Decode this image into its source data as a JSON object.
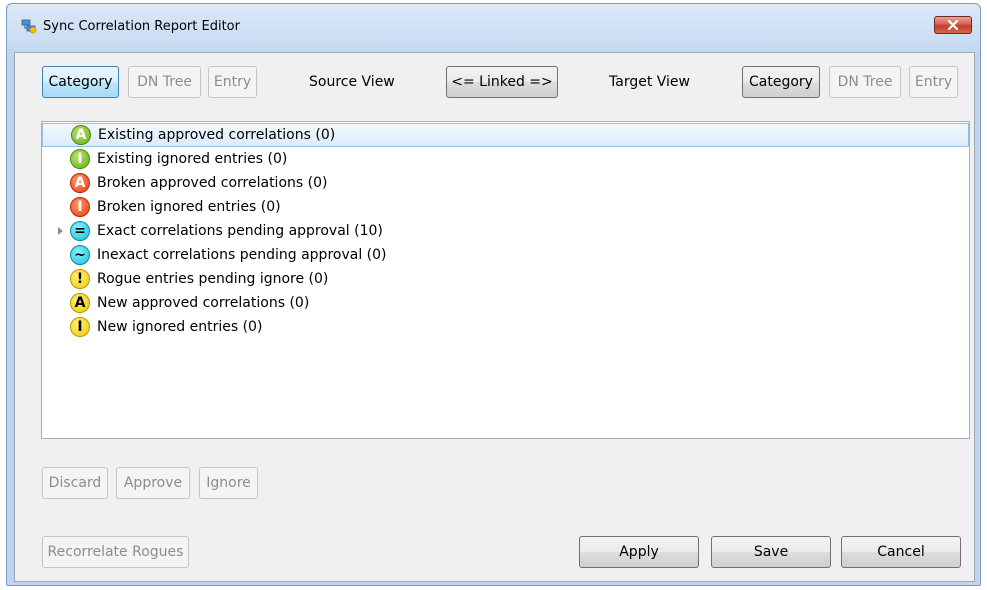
{
  "window": {
    "title": "Sync Correlation Report Editor",
    "close_glyph": "✕"
  },
  "toolbar": {
    "source_buttons": [
      {
        "label": "Category",
        "state": "active"
      },
      {
        "label": "DN Tree",
        "state": "disabled"
      },
      {
        "label": "Entry",
        "state": "disabled"
      }
    ],
    "source_view_label": "Source View",
    "linked_label": "<= Linked =>",
    "target_view_label": "Target View",
    "target_buttons": [
      {
        "label": "Category",
        "state": "normal"
      },
      {
        "label": "DN Tree",
        "state": "disabled"
      },
      {
        "label": "Entry",
        "state": "disabled"
      }
    ]
  },
  "tree": {
    "items": [
      {
        "icon": "existing-approved-icon",
        "glyph": "A",
        "color": "green",
        "label": "Existing approved correlations (0)",
        "selected": true,
        "expandable": false
      },
      {
        "icon": "existing-ignored-icon",
        "glyph": "I",
        "color": "green",
        "label": "Existing ignored entries (0)",
        "selected": false,
        "expandable": false
      },
      {
        "icon": "broken-approved-icon",
        "glyph": "A",
        "color": "red",
        "label": "Broken approved correlations (0)",
        "selected": false,
        "expandable": false
      },
      {
        "icon": "broken-ignored-icon",
        "glyph": "I",
        "color": "red",
        "label": "Broken ignored entries (0)",
        "selected": false,
        "expandable": false
      },
      {
        "icon": "exact-pending-icon",
        "glyph": "=",
        "color": "cyan",
        "label": "Exact correlations pending approval (10)",
        "selected": false,
        "expandable": true
      },
      {
        "icon": "inexact-pending-icon",
        "glyph": "~",
        "color": "cyan",
        "label": "Inexact correlations pending approval (0)",
        "selected": false,
        "expandable": false
      },
      {
        "icon": "rogue-pending-icon",
        "glyph": "!",
        "color": "yellow",
        "label": "Rogue entries pending ignore (0)",
        "selected": false,
        "expandable": false
      },
      {
        "icon": "new-approved-icon",
        "glyph": "A",
        "color": "yellow",
        "label": "New approved correlations (0)",
        "selected": false,
        "expandable": false
      },
      {
        "icon": "new-ignored-icon",
        "glyph": "I",
        "color": "yellow",
        "label": "New ignored entries (0)",
        "selected": false,
        "expandable": false
      }
    ]
  },
  "actions": {
    "discard": "Discard",
    "approve": "Approve",
    "ignore": "Ignore",
    "recorrelate": "Recorrelate Rogues"
  },
  "footer": {
    "apply": "Apply",
    "save": "Save",
    "cancel": "Cancel"
  },
  "colors": {
    "green": "#6aad17",
    "red": "#e8380d",
    "cyan": "#12bcd8",
    "yellow": "#f0c800",
    "selection": "#dcebfb"
  }
}
